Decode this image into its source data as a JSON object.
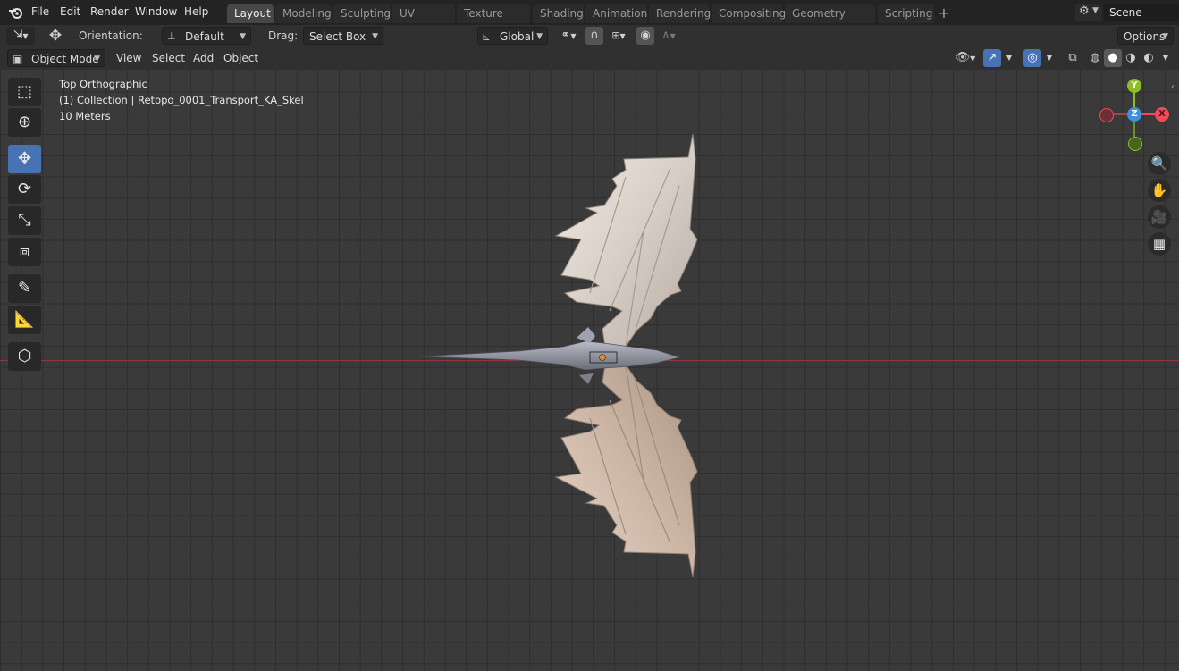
{
  "menubar": {
    "items": [
      "File",
      "Edit",
      "Render",
      "Window",
      "Help"
    ]
  },
  "workspaces": {
    "tabs": [
      "Layout",
      "Modeling",
      "Sculpting",
      "UV Editing",
      "Texture Paint",
      "Shading",
      "Animation",
      "Rendering",
      "Compositing",
      "Geometry Nodes",
      "Scripting"
    ],
    "active": "Layout"
  },
  "scene": {
    "name": "Scene"
  },
  "tool_header": {
    "orientation_label": "Orientation:",
    "orientation_value": "Default",
    "drag_label": "Drag:",
    "drag_value": "Select Box",
    "transform_orientation": "Global",
    "options_label": "Options"
  },
  "view_header": {
    "mode": "Object Mode",
    "menus": [
      "View",
      "Select",
      "Add",
      "Object"
    ]
  },
  "viewport": {
    "view_name": "Top Orthographic",
    "collection_info": "(1) Collection | Retopo_0001_Transport_KA_Skel",
    "scale_info": "10 Meters"
  },
  "gizmo": {
    "y": "Y",
    "z": "Z",
    "x": "X"
  },
  "colors": {
    "accent": "#4772b3",
    "x_axis": "#ee4b5c",
    "y_axis": "#8cbf26",
    "z_axis": "#3f8ee0"
  },
  "icons": {
    "blender_logo": "blender-logo-icon",
    "tools": [
      "select-box-icon",
      "cursor-icon",
      "move-icon",
      "rotate-icon",
      "scale-icon",
      "transform-icon",
      "annotate-icon",
      "measure-icon",
      "add-cube-icon"
    ],
    "nav": [
      "zoom-icon",
      "pan-hand-icon",
      "camera-icon",
      "grid-toggle-icon"
    ]
  }
}
